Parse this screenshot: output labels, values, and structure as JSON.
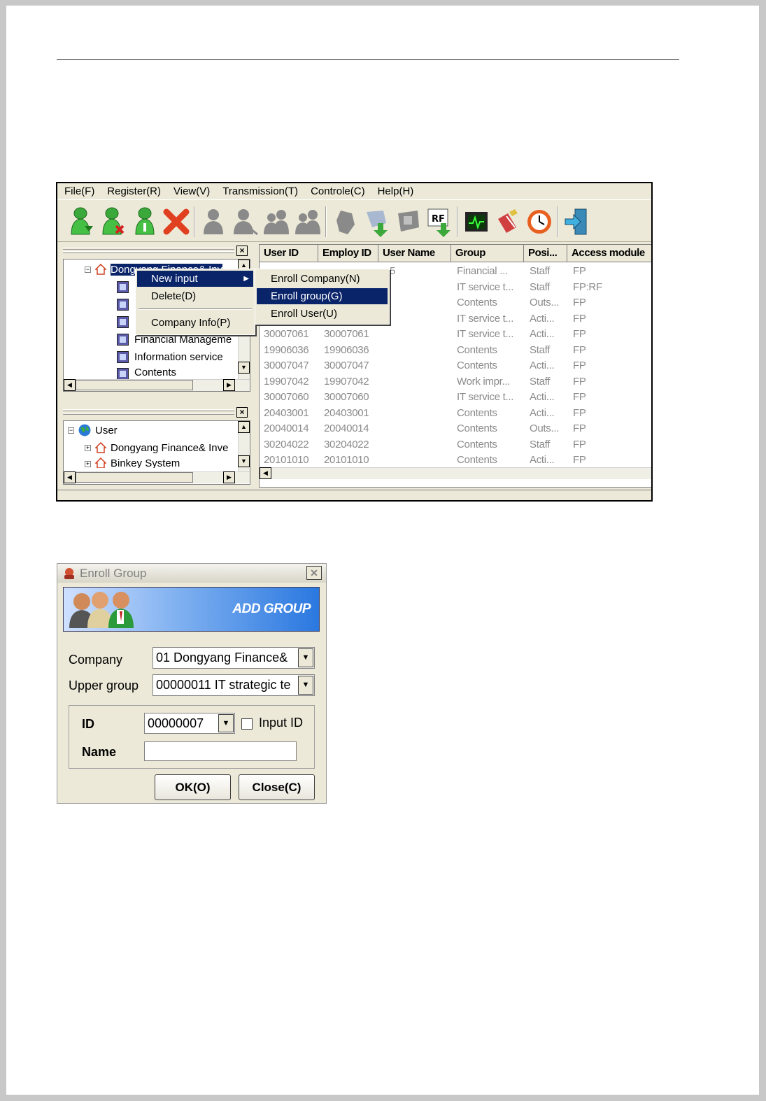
{
  "app": {
    "menu": [
      "File(F)",
      "Register(R)",
      "View(V)",
      "Transmission(T)",
      "Controle(C)",
      "Help(H)"
    ],
    "toolbar_icons": [
      "add-user-icon",
      "delete-user-icon",
      "user-info-icon",
      "delete-icon",
      "person-icon",
      "person-icon",
      "group-icon",
      "group-icon",
      "hand-icon",
      "download-icon",
      "fingerprint-icon",
      "rf-download-icon",
      "monitor-icon",
      "settings-icon",
      "clock-icon",
      "exit-icon"
    ],
    "toolbar_rf_text": "RF",
    "tree_top": {
      "root": "Dongyang Finance& Inv",
      "items": [
        "Financial Manageme",
        "Information service",
        "Contents"
      ]
    },
    "tree_bottom": {
      "root": "User",
      "items": [
        "Dongyang Finance& Inve",
        "Binkey System"
      ]
    },
    "context_menu": {
      "items": [
        "New input",
        "Delete(D)",
        "Company Info(P)"
      ],
      "submenu": [
        "Enroll Company(N)",
        "Enroll group(G)",
        "Enroll User(U)"
      ],
      "selected_submenu": "Enroll group(G)"
    },
    "grid": {
      "columns": [
        "User ID",
        "Employ ID",
        "User Name",
        "Group",
        "Posi...",
        "Access module"
      ],
      "partial_name": "e5",
      "rows": [
        {
          "user_id": "",
          "employ_id": "",
          "group": "Financial ...",
          "pos": "Staff",
          "access": "FP"
        },
        {
          "user_id": "",
          "employ_id": "",
          "group": "IT service t...",
          "pos": "Staff",
          "access": "FP:RF"
        },
        {
          "user_id": "",
          "employ_id": "",
          "group": "Contents",
          "pos": "Outs...",
          "access": "FP"
        },
        {
          "user_id": "",
          "employ_id": "",
          "group": "IT service t...",
          "pos": "Acti...",
          "access": "FP"
        },
        {
          "user_id": "30007061",
          "employ_id": "30007061",
          "group": "IT service t...",
          "pos": "Acti...",
          "access": "FP"
        },
        {
          "user_id": "19906036",
          "employ_id": "19906036",
          "group": "Contents",
          "pos": "Staff",
          "access": "FP"
        },
        {
          "user_id": "30007047",
          "employ_id": "30007047",
          "group": "Contents",
          "pos": "Acti...",
          "access": "FP"
        },
        {
          "user_id": "19907042",
          "employ_id": "19907042",
          "group": "Work impr...",
          "pos": "Staff",
          "access": "FP"
        },
        {
          "user_id": "30007060",
          "employ_id": "30007060",
          "group": "IT service t...",
          "pos": "Acti...",
          "access": "FP"
        },
        {
          "user_id": "20403001",
          "employ_id": "20403001",
          "group": "Contents",
          "pos": "Acti...",
          "access": "FP"
        },
        {
          "user_id": "20040014",
          "employ_id": "20040014",
          "group": "Contents",
          "pos": "Outs...",
          "access": "FP"
        },
        {
          "user_id": "30204022",
          "employ_id": "30204022",
          "group": "Contents",
          "pos": "Staff",
          "access": "FP"
        },
        {
          "user_id": "20101010",
          "employ_id": "20101010",
          "group": "Contents",
          "pos": "Acti...",
          "access": "FP"
        }
      ]
    }
  },
  "dialog": {
    "title": "Enroll Group",
    "banner": "ADD GROUP",
    "company_label": "Company",
    "company_value": "01 Dongyang Finance&",
    "upper_group_label": "Upper group",
    "upper_group_value": "00000011 IT strategic te",
    "id_label": "ID",
    "id_value": "00000007",
    "input_id_label": "Input ID",
    "input_id_checked": false,
    "name_label": "Name",
    "name_value": "",
    "ok_label": "OK(O)",
    "close_label": "Close(C)"
  }
}
